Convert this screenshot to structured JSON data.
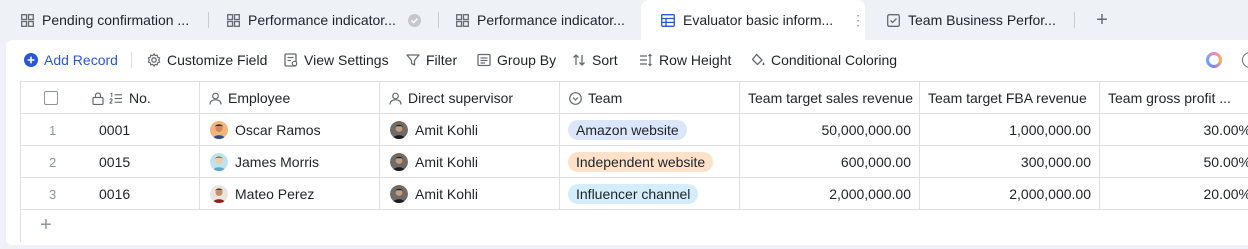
{
  "tabs": [
    {
      "label": "Pending confirmation ...",
      "icon": "grid-view-icon",
      "active": false
    },
    {
      "label": "Performance indicator...",
      "icon": "grid-view-icon",
      "active": false,
      "badge": "check-badge-icon"
    },
    {
      "label": "Performance indicator...",
      "icon": "grid-view-icon",
      "active": false
    },
    {
      "label": "Evaluator basic inform...",
      "icon": "table-view-icon",
      "active": true
    },
    {
      "label": "Team Business Perfor...",
      "icon": "form-view-icon",
      "active": false
    }
  ],
  "toolbar": {
    "add_record": "Add Record",
    "customize_field": "Customize Field",
    "view_settings": "View Settings",
    "filter": "Filter",
    "group_by": "Group By",
    "sort": "Sort",
    "row_height": "Row Height",
    "conditional_coloring": "Conditional Coloring"
  },
  "columns": [
    {
      "label": "No.",
      "icon": "autonumber-icon"
    },
    {
      "label": "Employee",
      "icon": "person-icon"
    },
    {
      "label": "Direct supervisor",
      "icon": "person-icon"
    },
    {
      "label": "Team",
      "icon": "single-select-icon"
    },
    {
      "label": "Team target sales revenue"
    },
    {
      "label": "Team target FBA revenue"
    },
    {
      "label": "Team gross profit ..."
    }
  ],
  "rows": [
    {
      "index": "1",
      "no": "0001",
      "employee": "Oscar Ramos",
      "supervisor": "Amit Kohli",
      "team": "Amazon website",
      "sales": "50,000,000.00",
      "fba": "1,000,000.00",
      "gross": "30.00%"
    },
    {
      "index": "2",
      "no": "0015",
      "employee": "James Morris",
      "supervisor": "Amit Kohli",
      "team": "Independent website",
      "sales": "600,000.00",
      "fba": "300,000.00",
      "gross": "50.00%"
    },
    {
      "index": "3",
      "no": "0016",
      "employee": "Mateo Perez",
      "supervisor": "Amit Kohli",
      "team": "Influencer channel",
      "sales": "2,000,000.00",
      "fba": "2,000,000.00",
      "gross": "20.00%"
    }
  ],
  "colors": {
    "accent": "#2858d9",
    "tag_amazon_bg": "#dce6fb",
    "tag_independent_bg": "#fde2c9",
    "tag_influencer_bg": "#d3eefa"
  }
}
